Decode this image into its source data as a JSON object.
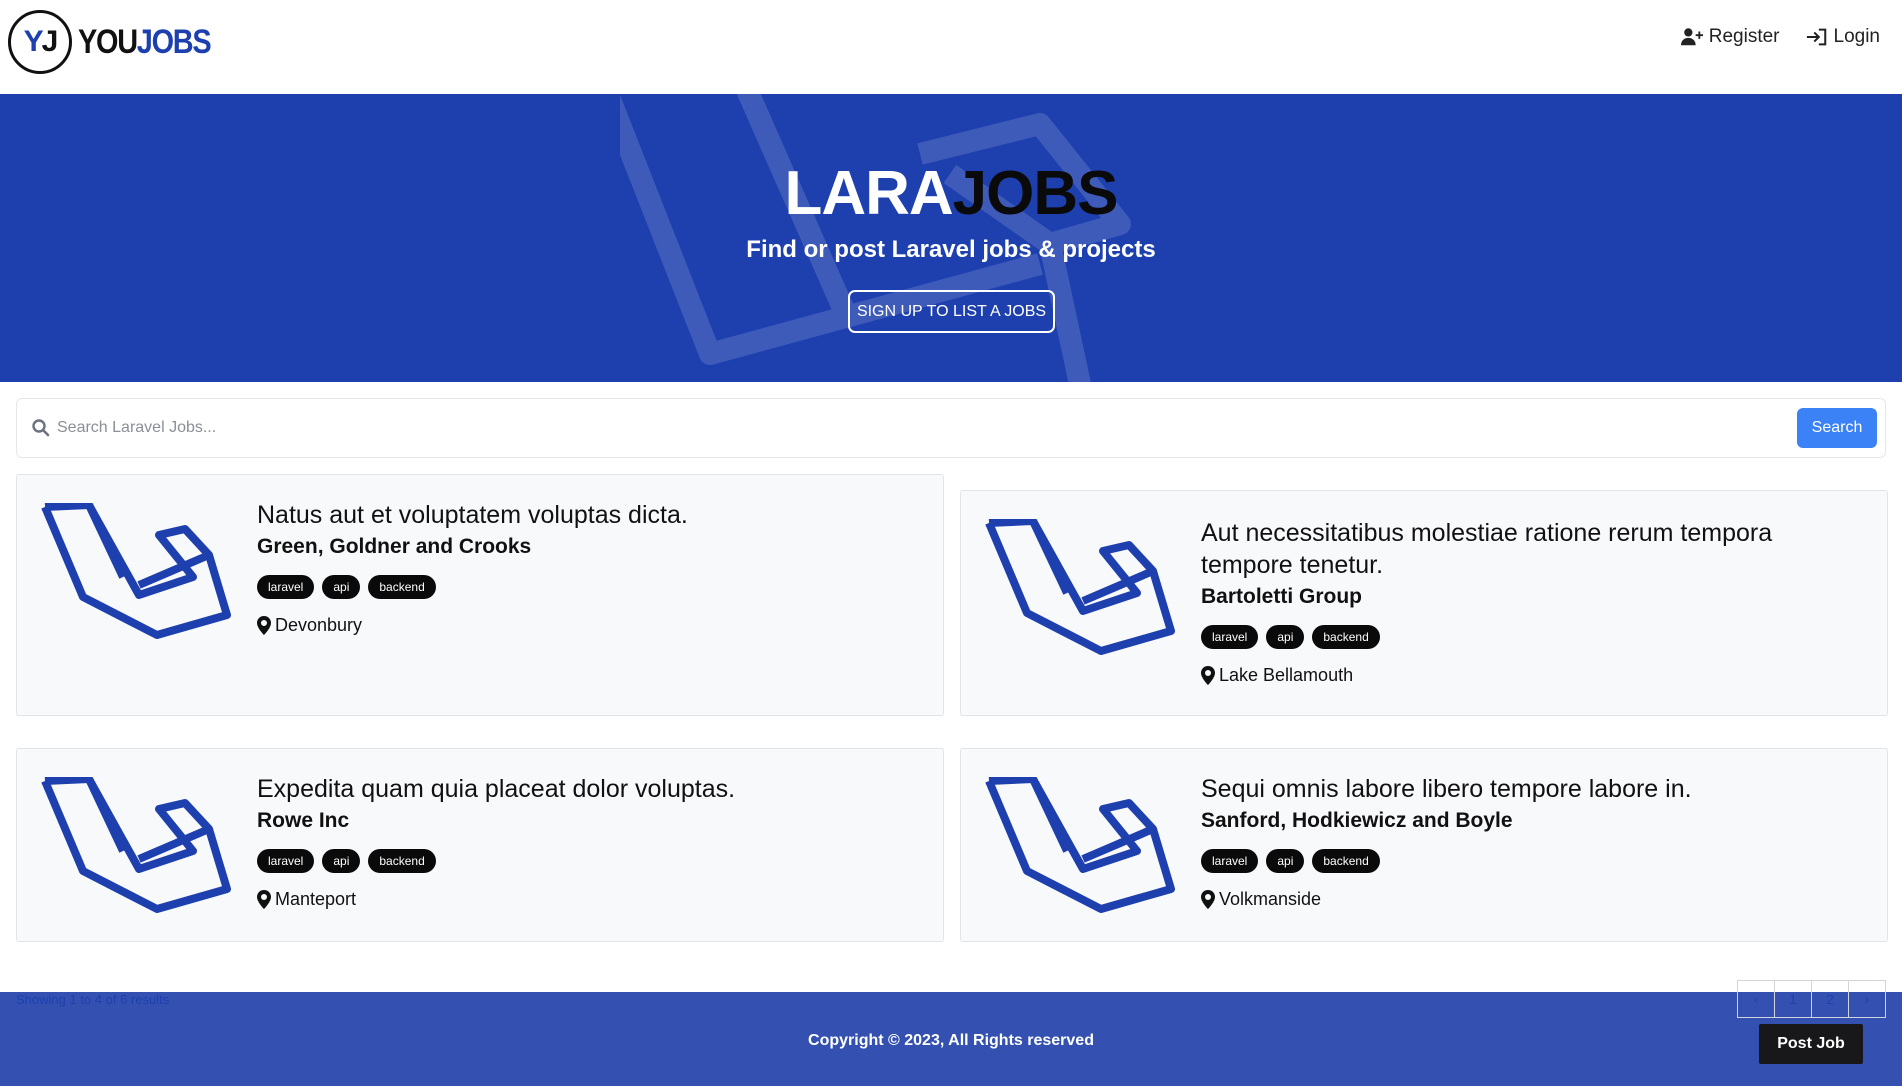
{
  "brand": {
    "circle_y": "Y",
    "circle_j": "J",
    "text_you": "YOU",
    "text_jobs": "JOBS"
  },
  "nav": {
    "register": "Register",
    "login": "Login"
  },
  "hero": {
    "title_lara": "LARA",
    "title_jobs": "JOBS",
    "subtitle": "Find or post Laravel jobs & projects",
    "button": "SIGN UP TO LIST A JOBS"
  },
  "search": {
    "placeholder": "Search Laravel Jobs...",
    "button": "Search"
  },
  "listings": [
    {
      "title": "Natus aut et voluptatem voluptas dicta.",
      "company": "Green, Goldner and Crooks",
      "tags": [
        "laravel",
        "api",
        "backend"
      ],
      "location": "Devonbury"
    },
    {
      "title": "Aut necessitatibus molestiae ratione rerum tempora tempore tenetur.",
      "company": "Bartoletti Group",
      "tags": [
        "laravel",
        "api",
        "backend"
      ],
      "location": "Lake Bellamouth"
    },
    {
      "title": "Expedita quam quia placeat dolor voluptas.",
      "company": "Rowe Inc",
      "tags": [
        "laravel",
        "api",
        "backend"
      ],
      "location": "Manteport"
    },
    {
      "title": "Sequi omnis labore libero tempore labore in.",
      "company": "Sanford, Hodkiewicz and Boyle",
      "tags": [
        "laravel",
        "api",
        "backend"
      ],
      "location": "Volkmanside"
    }
  ],
  "pagination": {
    "info": "Showing 1 to 4 of 6 results",
    "prev": "‹",
    "page1": "1",
    "page2": "2",
    "next": "›"
  },
  "footer": {
    "copyright": "Copyright © 2023, All Rights reserved",
    "post_job": "Post Job"
  },
  "colors": {
    "brand_blue": "#1e40af",
    "footer_blue": "#3451b2",
    "search_button": "#3b82f6",
    "tag_bg": "#0a0a0a"
  }
}
